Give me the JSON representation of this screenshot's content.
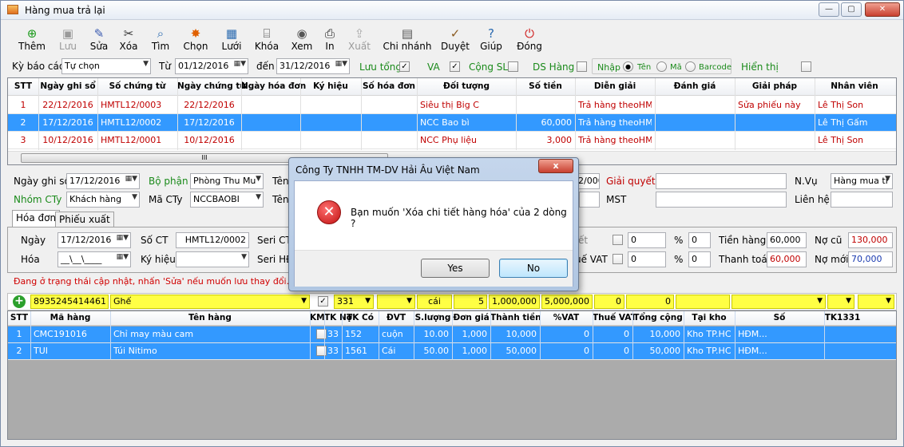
{
  "window": {
    "title": "Hàng mua trả lại"
  },
  "toolbar": [
    {
      "label": "Thêm",
      "icon": "add-icon",
      "disabled": false
    },
    {
      "label": "Lưu",
      "icon": "save-icon",
      "disabled": true
    },
    {
      "label": "Sửa",
      "icon": "edit-icon",
      "disabled": false
    },
    {
      "label": "Xóa",
      "icon": "delete-icon",
      "disabled": false
    },
    {
      "label": "Tìm",
      "icon": "find-icon",
      "disabled": false
    },
    {
      "label": "Chọn",
      "icon": "select-icon",
      "disabled": false
    },
    {
      "label": "Lưới",
      "icon": "grid-icon",
      "disabled": false
    },
    {
      "label": "Khóa",
      "icon": "lock-icon",
      "disabled": false
    },
    {
      "label": "Xem",
      "icon": "preview-icon",
      "disabled": false
    },
    {
      "label": "In",
      "icon": "print-icon",
      "disabled": false
    },
    {
      "label": "Xuất",
      "icon": "export-icon",
      "disabled": true
    },
    {
      "label": "Chi nhánh",
      "icon": "branch-icon",
      "disabled": false
    },
    {
      "label": "Duyệt",
      "icon": "approve-icon",
      "disabled": false
    },
    {
      "label": "Giúp",
      "icon": "help-icon",
      "disabled": false
    },
    {
      "label": "Đóng",
      "icon": "power-icon",
      "disabled": false
    }
  ],
  "filter": {
    "period_label": "Kỳ báo cáo",
    "period_value": "Tự chọn",
    "from_label": "Từ",
    "from_value": "01/12/2016",
    "to_label": "đến",
    "to_value": "31/12/2016",
    "save_total": "Lưu tổng",
    "va": "VA",
    "sum_qty": "Cộng SL",
    "item_list": "DS Hàng",
    "input_label": "Nhập",
    "opt_name": "Tên",
    "opt_code": "Mã",
    "opt_barcode": "Barcode",
    "show_label": "Hiển thị"
  },
  "top_grid": {
    "headers": [
      "STT",
      "Ngày ghi sổ",
      "Số chứng từ",
      "Ngày chứng từ",
      "Ngày hóa đơn",
      "Ký hiệu",
      "Số hóa đơn",
      "Đối tượng",
      "Số tiền",
      "Diễn giải",
      "Đánh giá",
      "Giải pháp",
      "Nhân viên"
    ],
    "rows": [
      [
        "1",
        "22/12/2016",
        "HMTL12/0003",
        "22/12/2016",
        "",
        "",
        "",
        "Siêu thị Big C",
        "",
        "Trả hàng theoHM...",
        "",
        "Sửa phiếu này",
        "Lê Thị Son"
      ],
      [
        "2",
        "17/12/2016",
        "HMTL12/0002",
        "17/12/2016",
        "",
        "",
        "",
        "NCC Bao bì",
        "60,000",
        "Trả hàng theoHM...",
        "",
        "",
        "Lê Thị Gấm"
      ],
      [
        "3",
        "10/12/2016",
        "HMTL12/0001",
        "10/12/2016",
        "",
        "",
        "",
        "NCC Phụ liệu",
        "3,000",
        "Trả hàng theoHM...",
        "",
        "",
        "Lê Thị Son"
      ]
    ],
    "scroll_label": "III"
  },
  "form": {
    "ngay_ghi_so_label": "Ngày ghi sổ",
    "ngay_ghi_so": "17/12/2016",
    "bo_phan_label": "Bộ phận",
    "bo_phan": "Phòng Thu Mu",
    "ten_label": "Tên",
    "giai_quyet_label": "Giải quyết",
    "nvu_label": "N.Vụ",
    "nvu": "Hàng mua tr",
    "nhom_cty_label": "Nhóm CTy",
    "nhom_cty": "Khách hàng",
    "ma_cty_label": "Mã CTy",
    "ma_cty": "NCCBAOBI",
    "mst_label": "MST",
    "lien_he_label": "Liên hệ",
    "partial_num": "2/000"
  },
  "tabs": [
    "Hóa đơn",
    "Phiếu xuất"
  ],
  "invoice": {
    "ngay_label": "Ngày",
    "ngay": "17/12/2016",
    "so_ct_label": "Số CT",
    "so_ct": "HMTL12/0002",
    "seri_ct_label": "Seri CT",
    "hoa_label": "Hóa",
    "hoa": "__\\__\\____",
    "ky_hieu_label": "Ký hiệu",
    "seri_hd_label": "Seri HĐ",
    "ck_label": "ết",
    "vat_label": "uế VAT",
    "v1": "0",
    "p1": "0",
    "v2": "0",
    "p2": "0",
    "pct": "%",
    "tien_hang_label": "Tiền hàng",
    "tien_hang": "60,000",
    "no_cu_label": "Nợ cũ",
    "no_cu": "130,000",
    "thanh_toan_label": "Thanh toán",
    "thanh_toan": "60,000",
    "no_moi_label": "Nợ mới",
    "no_moi": "70,000"
  },
  "status": "Đang ở trạng thái cập nhật, nhấn 'Sửa' nếu muốn lưu thay đổi.",
  "entry": {
    "barcode": "8935245414461",
    "name": "Ghế",
    "tk": "331",
    "dvt": "cái",
    "qty": "5",
    "price": "1,000,000",
    "amount": "5,000,000",
    "vat": "0",
    "tax": "0"
  },
  "detail_grid": {
    "headers": [
      "STT",
      "Mã hàng",
      "Tên hàng",
      "KM",
      "TK Nợ",
      "TK Có",
      "ĐVT",
      "S.lượng",
      "Đơn giá",
      "Thành tiền",
      "%VAT",
      "Thuế VAT",
      "Tổng cộng",
      "Tại kho",
      "Số",
      "TK1331"
    ],
    "rows": [
      [
        "1",
        "CMC191016",
        "Chỉ may màu cam",
        "",
        "331",
        "152",
        "cuộn",
        "10.00",
        "1,000",
        "10,000",
        "0",
        "0",
        "10,000",
        "Kho TP.HCM",
        "HĐM..."
      ],
      [
        "2",
        "TUI",
        "Túi Nitimo",
        "",
        "331",
        "1561",
        "Cái",
        "50.00",
        "1,000",
        "50,000",
        "0",
        "0",
        "50,000",
        "Kho TP.HCM",
        "HĐM..."
      ]
    ]
  },
  "dialog": {
    "title": "Công Ty TNHH TM-DV Hải Âu Việt Nam",
    "message": "Bạn muốn 'Xóa chi tiết hàng hóa' của 2 dòng ?",
    "yes": "Yes",
    "no": "No",
    "close": "x"
  }
}
